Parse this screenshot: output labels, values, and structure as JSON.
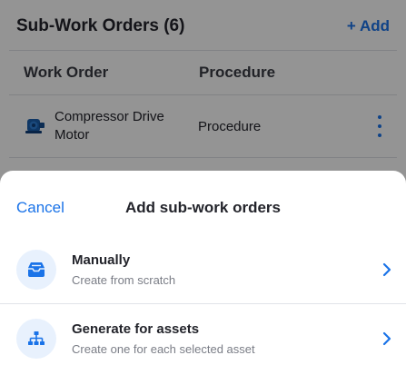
{
  "background": {
    "title": "Sub-Work Orders (6)",
    "add_label": "+ Add",
    "columns": [
      "Work Order",
      "Procedure"
    ],
    "rows": [
      {
        "name": "Compressor Drive Motor",
        "procedure": "Procedure"
      }
    ]
  },
  "sheet": {
    "cancel_label": "Cancel",
    "title": "Add sub-work orders",
    "options": [
      {
        "label": "Manually",
        "description": "Create from scratch",
        "icon": "inbox-tray-icon"
      },
      {
        "label": "Generate for assets",
        "description": "Create one for each selected asset",
        "icon": "hierarchy-icon"
      }
    ]
  },
  "colors": {
    "accent": "#1a73e8",
    "icon_circle": "#e8f1fd",
    "scrim": "rgba(0,0,0,0.42)"
  }
}
